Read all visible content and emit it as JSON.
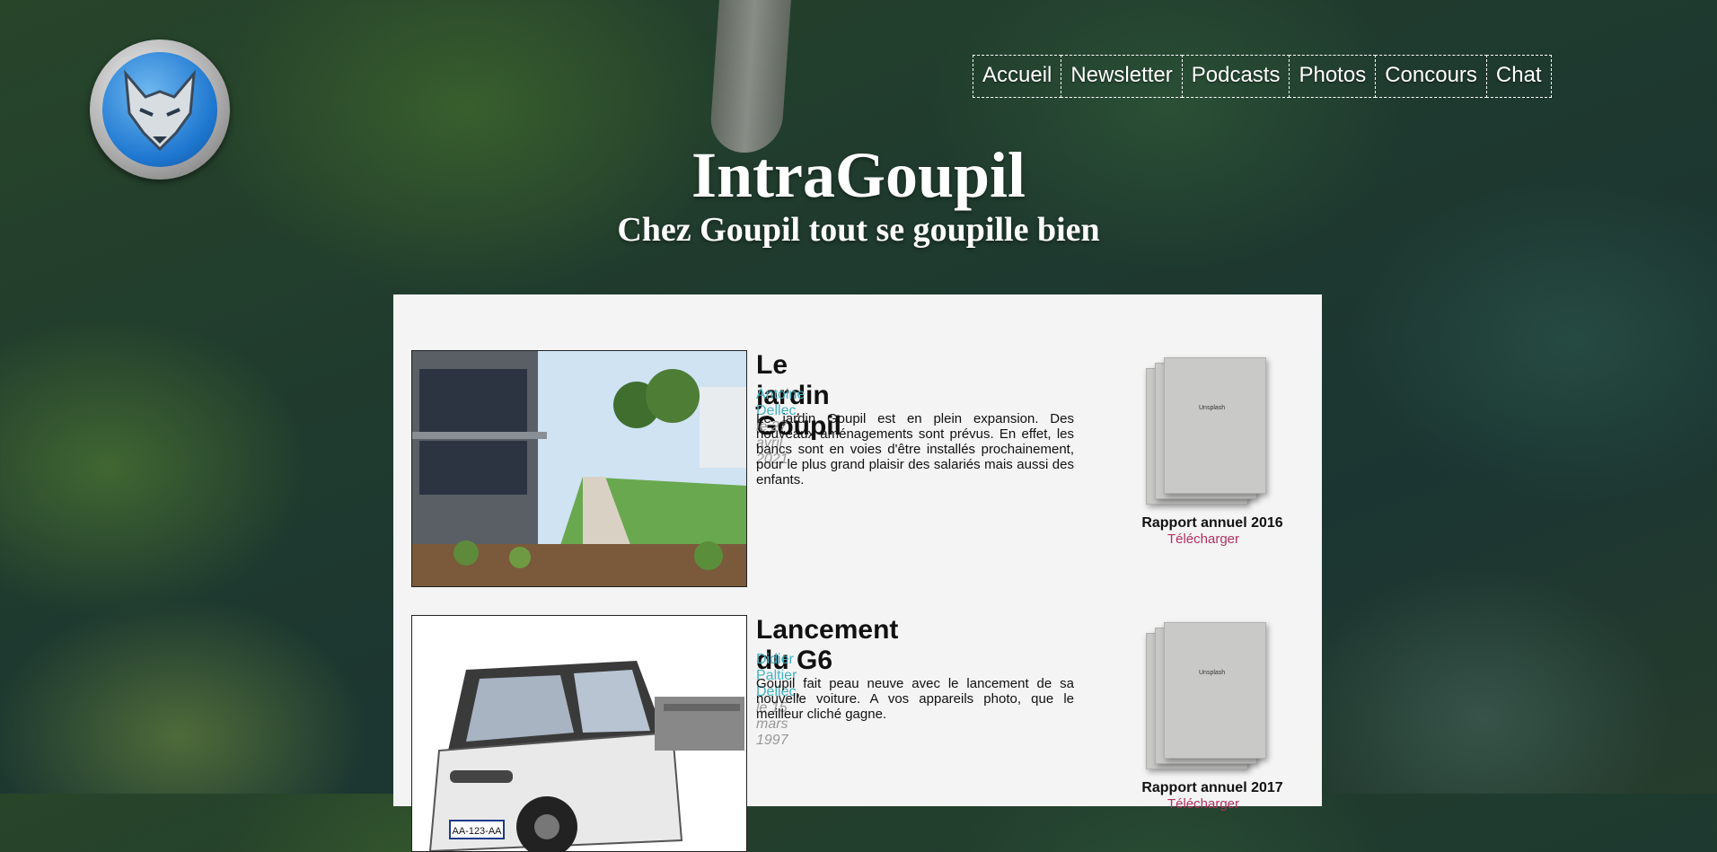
{
  "header": {
    "logo": "fox-logo",
    "title": "IntraGoupil",
    "subtitle": "Chez Goupil tout se goupille bien"
  },
  "nav": {
    "items": [
      {
        "label": "Accueil"
      },
      {
        "label": "Newsletter"
      },
      {
        "label": "Podcasts"
      },
      {
        "label": "Photos"
      },
      {
        "label": "Concours"
      },
      {
        "label": "Chat"
      }
    ]
  },
  "articles": [
    {
      "title": "Le jardin Goupil",
      "author": "Antoine Dellec",
      "date": "le 27 avril 2021",
      "excerpt": "Le jardin Goupil est en plein expansion. Des nouveaux aménagements sont prévus. En effet, les bancs sont en voies d'être installés prochainement, pour le plus grand plaisir des salariés mais aussi des enfants.",
      "image": "garden-building-photo"
    },
    {
      "title": "Lancement du G6",
      "author": "Didier Paltier Dellec",
      "date": "le 15 mars 1997",
      "excerpt": "Goupil fait peau neuve avec le lancement de sa nouvelle voiture. A vos appareils photo, que le meilleur cliché gagne.",
      "image": "utility-vehicle-photo",
      "plate": "AA-123-AA"
    }
  ],
  "reports": [
    {
      "title": "Rapport annuel 2016",
      "download": "Télécharger",
      "cover_text": "Unsplash"
    },
    {
      "title": "Rapport annuel 2017",
      "download": "Télécharger",
      "cover_text": "Unsplash"
    }
  ]
}
